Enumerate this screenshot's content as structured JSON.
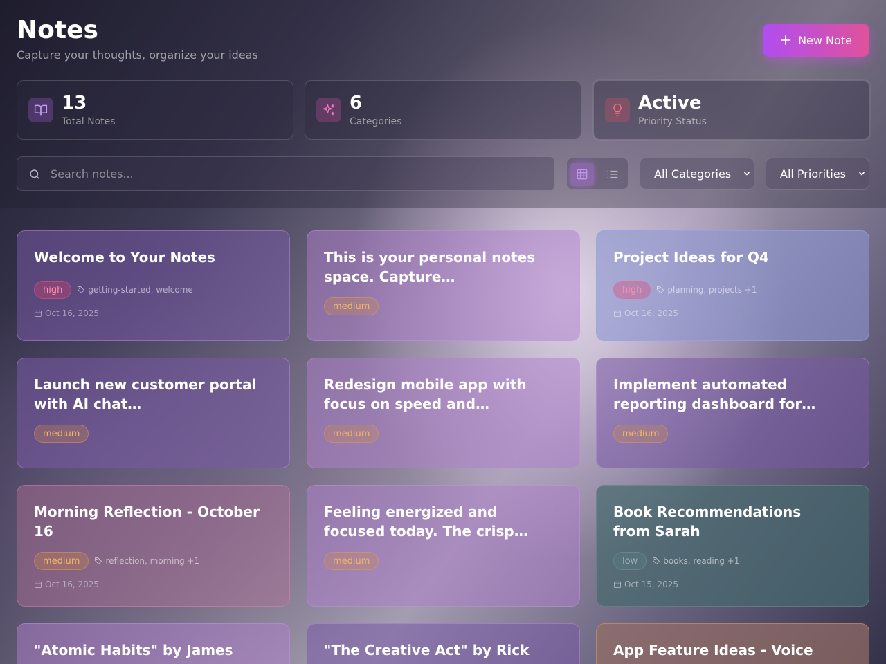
{
  "header": {
    "title": "Notes",
    "subtitle": "Capture your thoughts, organize your ideas",
    "new_note_label": "New Note"
  },
  "stats": [
    {
      "value": "13",
      "label": "Total Notes",
      "icon": "book-open-icon",
      "color": "#b77ee0"
    },
    {
      "value": "6",
      "label": "Categories",
      "icon": "sparkles-icon",
      "color": "#e06bb4"
    },
    {
      "value": "Active",
      "label": "Priority Status",
      "icon": "lightbulb-icon",
      "color": "#ef6a7a"
    }
  ],
  "toolbar": {
    "search_placeholder": "Search notes...",
    "category_select": "All Categories",
    "priority_select": "All Priorities",
    "view_mode": "grid"
  },
  "notes": [
    {
      "title": "Welcome to Your Notes",
      "priority": "high",
      "tags": "getting-started, welcome",
      "date": "Oct 16, 2025"
    },
    {
      "title": "This is your personal notes space. Capture…",
      "priority": "medium"
    },
    {
      "title": "Project Ideas for Q4",
      "priority": "high",
      "tags": "planning, projects +1",
      "date": "Oct 16, 2025"
    },
    {
      "title": "Launch new customer portal with AI chat…",
      "priority": "medium"
    },
    {
      "title": "Redesign mobile app with focus on speed and…",
      "priority": "medium"
    },
    {
      "title": "Implement automated reporting dashboard for…",
      "priority": "medium"
    },
    {
      "title": "Morning Reflection - October 16",
      "priority": "medium",
      "tags": "reflection, morning +1",
      "date": "Oct 16, 2025"
    },
    {
      "title": "Feeling energized and focused today. The crisp…",
      "priority": "medium"
    },
    {
      "title": "Book Recommendations from Sarah",
      "priority": "low",
      "tags": "books, reading +1",
      "date": "Oct 15, 2025"
    },
    {
      "title": "\"Atomic Habits\" by James"
    },
    {
      "title": "\"The Creative Act\" by Rick"
    },
    {
      "title": "App Feature Ideas - Voice"
    }
  ]
}
